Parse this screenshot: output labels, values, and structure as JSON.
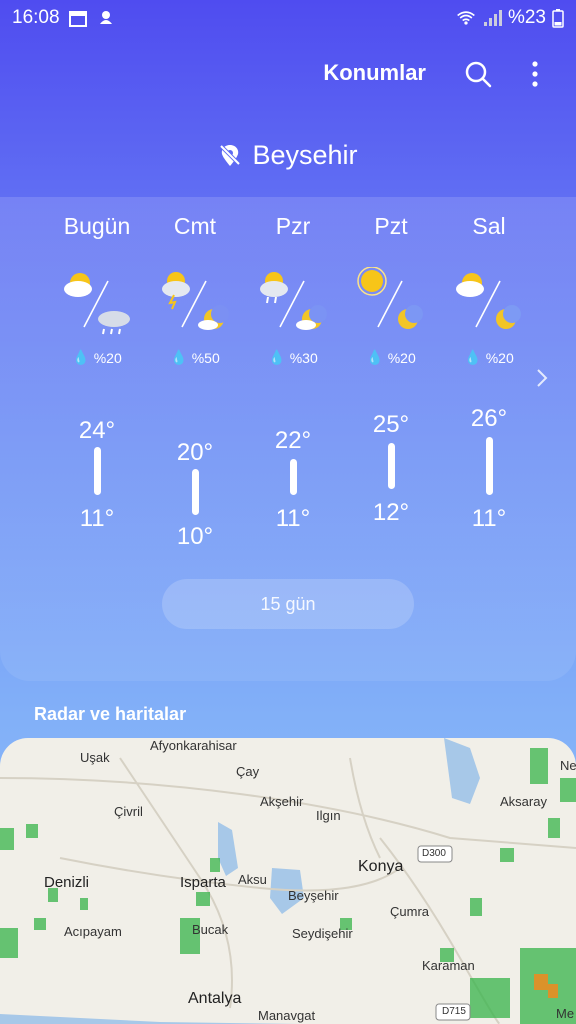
{
  "status": {
    "time": "16:08",
    "battery": "%23"
  },
  "appbar": {
    "locations_label": "Konumlar"
  },
  "location": {
    "name": "Beysehir"
  },
  "forecast": [
    {
      "day": "Bugün",
      "rain": "%20",
      "high": "24°",
      "low": "11°",
      "day_icon": "partly-cloudy-icon",
      "night_icon": "cloud-rain-icon"
    },
    {
      "day": "Cmt",
      "rain": "%50",
      "high": "20°",
      "low": "10°",
      "day_icon": "thunderstorm-icon",
      "night_icon": "moon-cloud-icon"
    },
    {
      "day": "Pzr",
      "rain": "%30",
      "high": "22°",
      "low": "11°",
      "day_icon": "sun-rain-icon",
      "night_icon": "moon-cloud-icon"
    },
    {
      "day": "Pzt",
      "rain": "%20",
      "high": "25°",
      "low": "12°",
      "day_icon": "sun-icon",
      "night_icon": "moon-icon"
    },
    {
      "day": "Sal",
      "rain": "%20",
      "high": "26°",
      "low": "11°",
      "day_icon": "partly-cloudy-icon",
      "night_icon": "moon-icon"
    }
  ],
  "more_days_label": "15 gün",
  "radar": {
    "title": "Radar ve haritalar",
    "places": [
      "Uşak",
      "Afyonkarahisar",
      "Çay",
      "Akşehir",
      "Ilgın",
      "Aksaray",
      "Çivril",
      "Konya",
      "D300",
      "Denizli",
      "Isparta",
      "Aksu",
      "Beyşehir",
      "Çumra",
      "Acıpayam",
      "Bucak",
      "Seydişehir",
      "Karaman",
      "Antalya",
      "Manavgat",
      "D715",
      "Ne",
      "Me"
    ]
  },
  "colors": {
    "bg_top": "#4f4cf0",
    "bg_bottom": "#8fc0fb",
    "sun": "#f7c519",
    "moon": "#f2c526",
    "radar_green": "#37b44a"
  }
}
